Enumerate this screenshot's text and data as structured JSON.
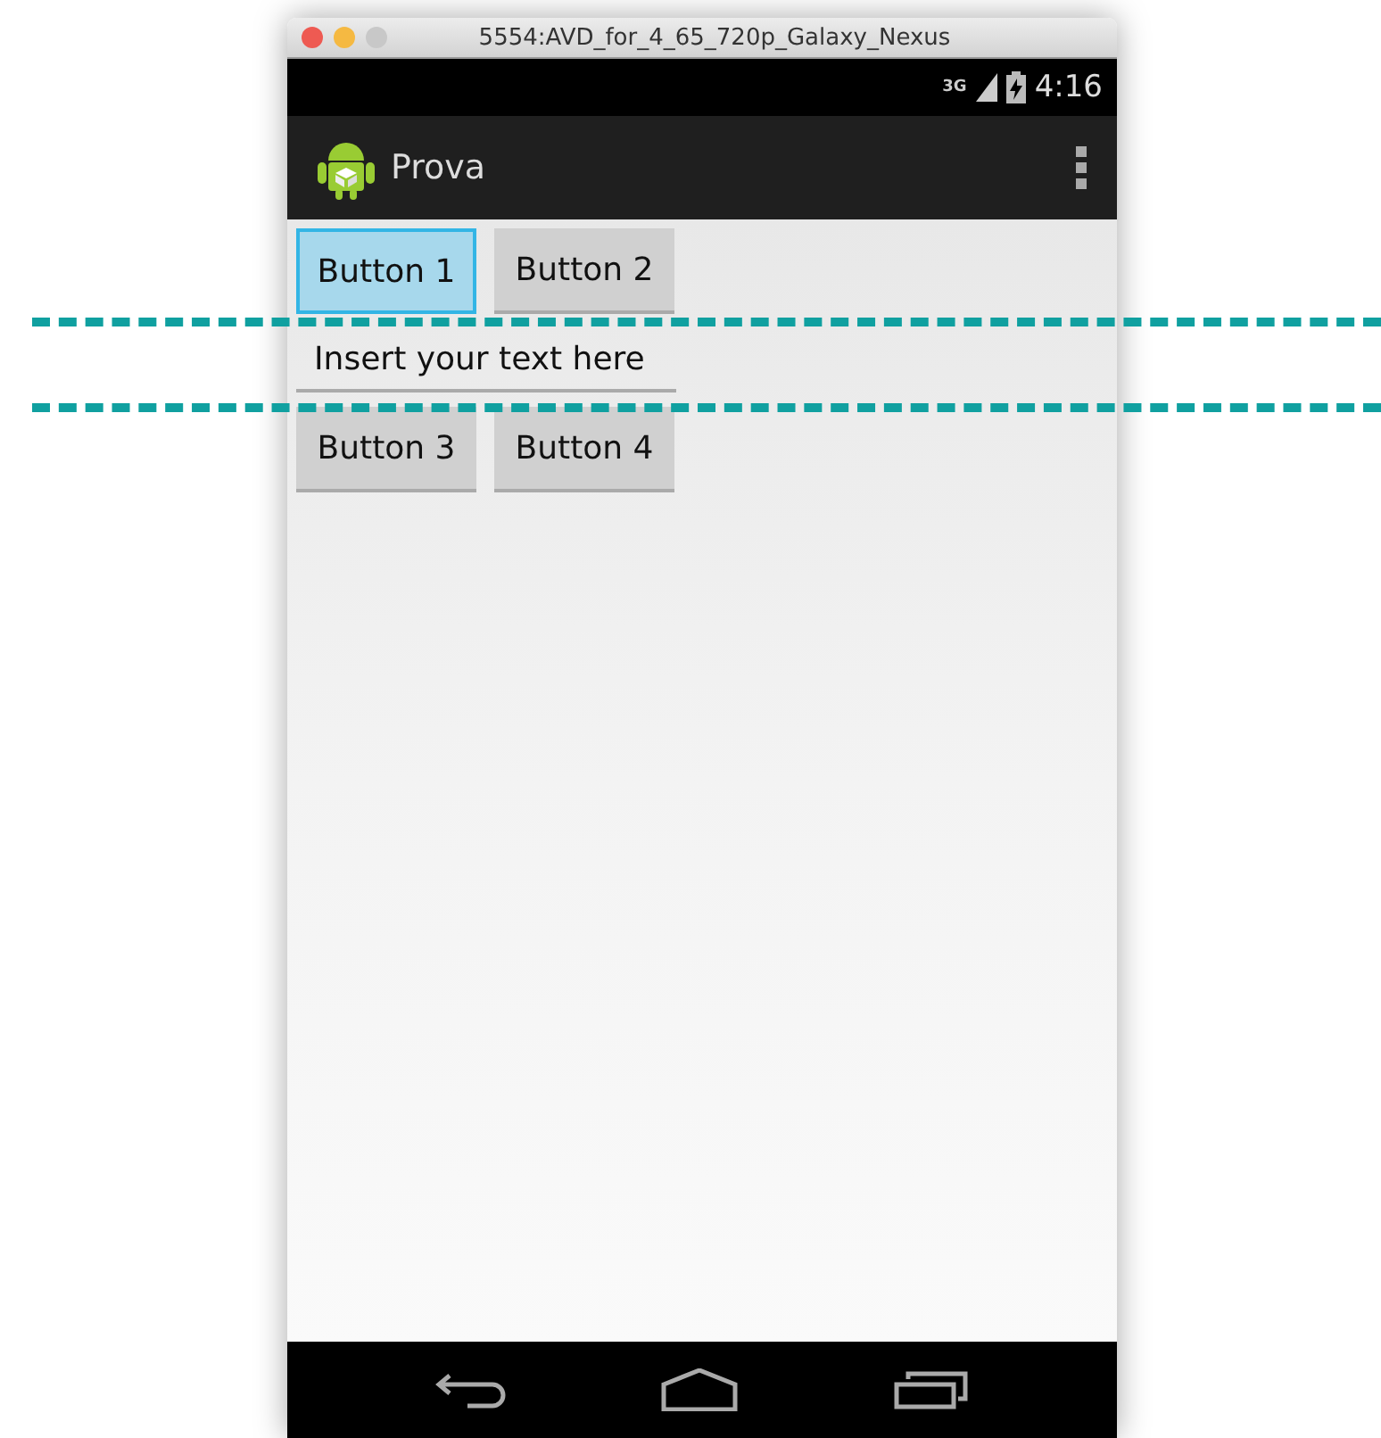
{
  "window": {
    "title": "5554:AVD_for_4_65_720p_Galaxy_Nexus"
  },
  "status_bar": {
    "time": "4:16",
    "network": "3G"
  },
  "action_bar": {
    "title": "Prova"
  },
  "rows": [
    {
      "kind": "buttons",
      "buttons": [
        {
          "label": "Button 1",
          "focused": true
        },
        {
          "label": "Button 2",
          "focused": false
        }
      ]
    },
    {
      "kind": "field",
      "placeholder": "Insert your text here"
    },
    {
      "kind": "buttons",
      "buttons": [
        {
          "label": "Button 3",
          "focused": false
        },
        {
          "label": "Button 4",
          "focused": false
        }
      ]
    }
  ]
}
